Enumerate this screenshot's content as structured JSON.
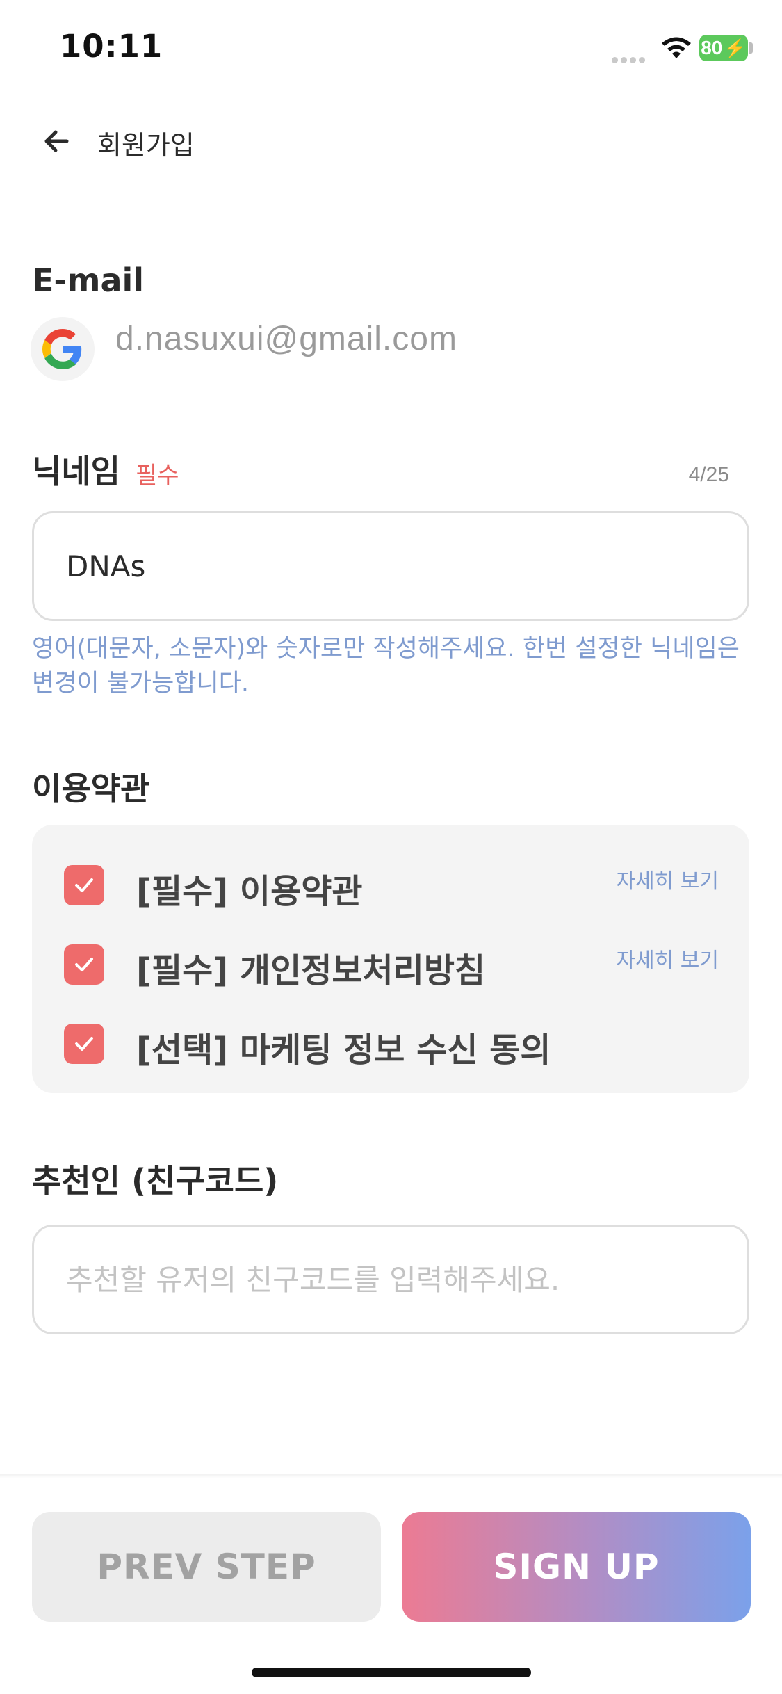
{
  "status_bar": {
    "time": "10:11",
    "battery": "80"
  },
  "header": {
    "title": "회원가입"
  },
  "email": {
    "label": "E-mail",
    "value": "d.nasuxui@gmail.com"
  },
  "nickname": {
    "label": "닉네임",
    "required_tag": "필수",
    "counter": "4/25",
    "value": "DNAs",
    "helper": "영어(대문자, 소문자)와 숫자로만 작성해주세요. 한번 설정한 닉네임은 변경이 불가능합니다."
  },
  "terms": {
    "label": "이용약관",
    "items": [
      {
        "label": "[필수] 이용약관",
        "link": "자세히 보기",
        "checked": true
      },
      {
        "label": "[필수] 개인정보처리방침",
        "link": "자세히 보기",
        "checked": true
      },
      {
        "label": "[선택] 마케팅 정보 수신 동의",
        "checked": true
      }
    ]
  },
  "referral": {
    "label": "추천인 (친구코드)",
    "value": "",
    "placeholder": "추천할 유저의 친구코드를 입력해주세요."
  },
  "buttons": {
    "prev": "PREV STEP",
    "signup": "SIGN UP"
  },
  "colors": {
    "accent_red": "#ee6b6b",
    "link_blue": "#7f9bcf",
    "gradient_start": "#ec7b93",
    "gradient_end": "#7ba1ea"
  }
}
